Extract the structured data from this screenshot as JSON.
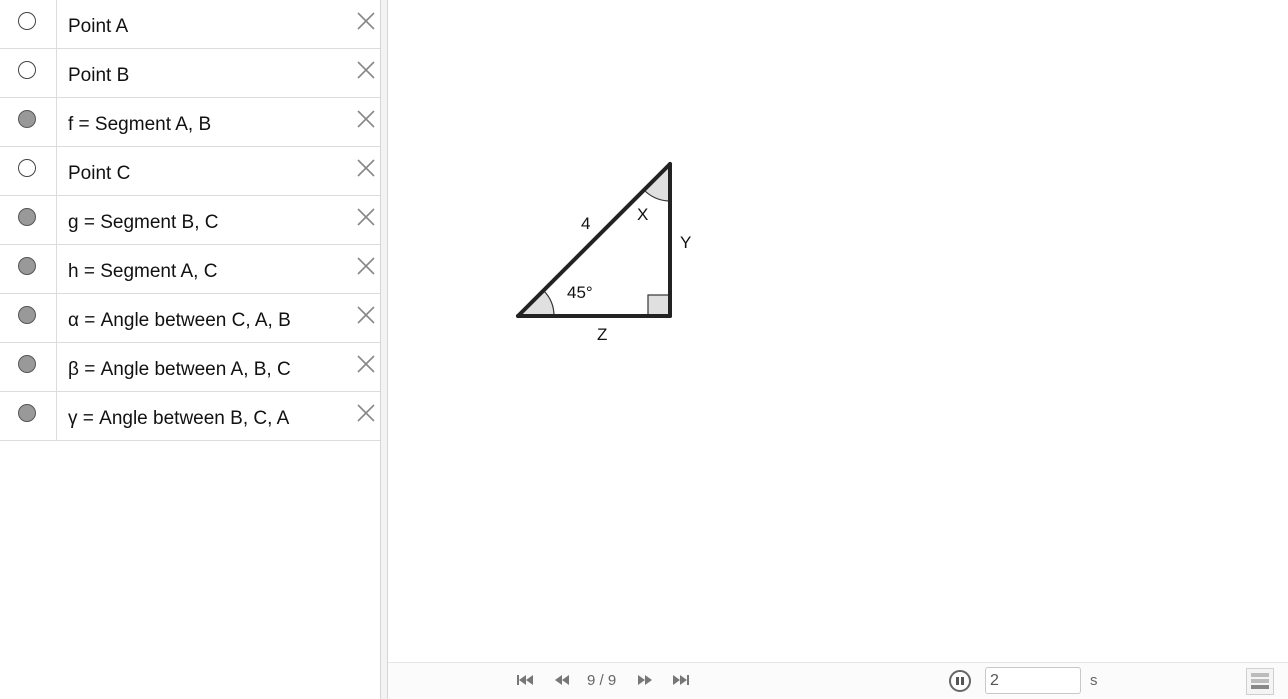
{
  "algebra": {
    "rows": [
      {
        "label": "Point A",
        "visible": false
      },
      {
        "label": "Point B",
        "visible": false
      },
      {
        "label": "f = Segment A, B",
        "visible": true
      },
      {
        "label": "Point C",
        "visible": false
      },
      {
        "label": "g = Segment B, C",
        "visible": true
      },
      {
        "label": "h = Segment A, C",
        "visible": true
      },
      {
        "label": "α = Angle between C, A, B",
        "visible": true
      },
      {
        "label": "β = Angle between A, B, C",
        "visible": true
      },
      {
        "label": "γ = Angle between B, C, A",
        "visible": true
      }
    ]
  },
  "graphics": {
    "hypotenuse_label": "4",
    "angle_label": "45°",
    "top_angle_label": "X",
    "vertical_side_label": "Y",
    "bottom_side_label": "Z"
  },
  "playback": {
    "counter": "9 / 9",
    "speed_value": "2",
    "speed_unit": "s",
    "icons": [
      "first-page-icon",
      "previous-page-icon",
      "next-page-icon",
      "last-page-icon",
      "pause-icon",
      "algebra-view-icon"
    ]
  },
  "colors": {
    "marble_on": "#999999",
    "segment": "#222222",
    "angle_fill": "#e0e0e0"
  }
}
